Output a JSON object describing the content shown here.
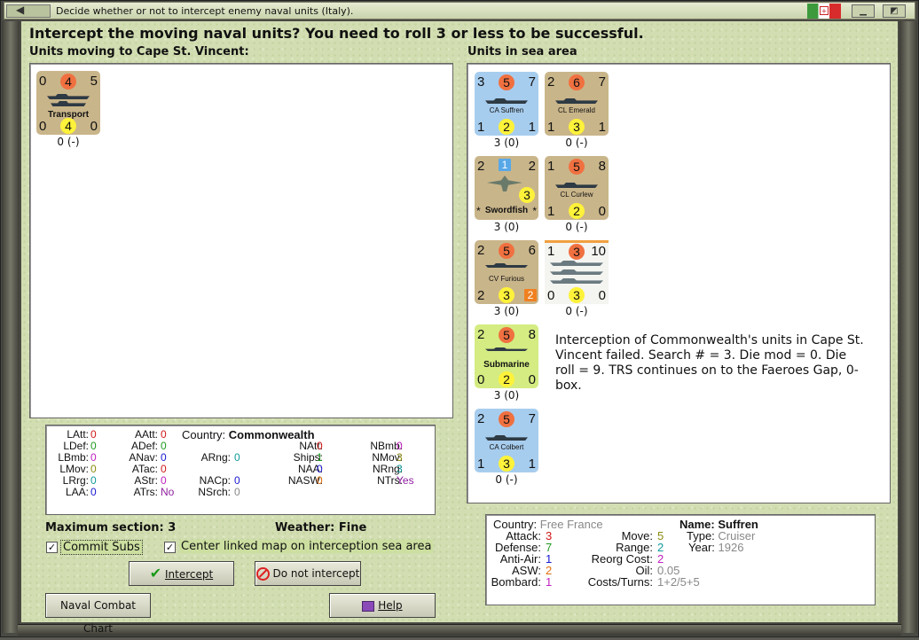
{
  "window": {
    "title": "Decide whether or not to intercept enemy naval units (Italy)."
  },
  "heading": "Intercept the moving naval units?  You need to roll 3 or less to be successful.",
  "left_panel_label": "Units moving to Cape St. Vincent:",
  "right_panel_label": "Units in sea area",
  "moving_units": [
    {
      "tl": "0",
      "tc": "4",
      "tr": "5",
      "name": "Transport",
      "bl": "0",
      "bc": "4",
      "br": "0",
      "status": "0 (-)"
    }
  ],
  "sea_units": [
    {
      "tl": "3",
      "tc": "5",
      "tr": "7",
      "name": "CA Suffren",
      "bl": "1",
      "bc": "2",
      "br": "1",
      "status": "3 (0)"
    },
    {
      "tl": "2",
      "tc": "6",
      "tr": "7",
      "name": "CL Emerald",
      "bl": "1",
      "bc": "3",
      "br": "1",
      "status": "0 (-)"
    },
    {
      "tl": "2",
      "tc": "1",
      "tr": "2",
      "name": "Swordfish",
      "bl": "*",
      "bc": "3",
      "br": "*",
      "status": "3 (0)"
    },
    {
      "tl": "1",
      "tc": "5",
      "tr": "8",
      "name": "CL Curlew",
      "bl": "1",
      "bc": "2",
      "br": "0",
      "status": "0 (-)"
    },
    {
      "tl": "2",
      "tc": "5",
      "tr": "6",
      "name": "CV Furious",
      "bl": "2",
      "bc": "3",
      "br": "2",
      "status": "3 (0)"
    },
    {
      "tl": "1",
      "tc": "3",
      "tr": "10",
      "name": "",
      "bl": "0",
      "bc": "3",
      "br": "0",
      "status": "0 (-)"
    },
    {
      "tl": "2",
      "tc": "5",
      "tr": "8",
      "name": "Submarine",
      "bl": "0",
      "bc": "2",
      "br": "0",
      "status": "3 (0)"
    },
    {
      "tl": "2",
      "tc": "5",
      "tr": "7",
      "name": "CA Colbert",
      "bl": "1",
      "bc": "3",
      "br": "1",
      "status": "0 (-)"
    }
  ],
  "message": "Interception of Commonwealth's units in Cape St. Vincent failed.  Search # = 3.  Die mod = 0.  Die roll = 9.  TRS continues on to the Faeroes Gap, 0-box.",
  "stats": {
    "country_label": "Country:",
    "country": "Commonwealth",
    "col1": [
      {
        "k": "LAtt:",
        "v": "0",
        "c": "#d01818"
      },
      {
        "k": "LDef:",
        "v": "0",
        "c": "#1e9a1e"
      },
      {
        "k": "LBmb:",
        "v": "0",
        "c": "#c020c0"
      },
      {
        "k": "LMov:",
        "v": "0",
        "c": "#8a8a10"
      },
      {
        "k": "LRrg:",
        "v": "0",
        "c": "#109a9a"
      },
      {
        "k": "LAA:",
        "v": "0",
        "c": "#1818d0"
      }
    ],
    "col2": [
      {
        "k": "AAtt:",
        "v": "0",
        "c": "#d01818"
      },
      {
        "k": "ADef:",
        "v": "0",
        "c": "#1e9a1e"
      },
      {
        "k": "ANav:",
        "v": "0",
        "c": "#1818d0"
      },
      {
        "k": "ATac:",
        "v": "0",
        "c": "#d01818"
      },
      {
        "k": "AStr:",
        "v": "0",
        "c": "#c020c0"
      },
      {
        "k": "ATrs:",
        "v": "No",
        "c": "#9020a0"
      }
    ],
    "col3": [
      {
        "k": "ARng:",
        "v": "0",
        "c": "#109a9a"
      },
      {
        "k": "NACp:",
        "v": "0",
        "c": "#1818d0"
      },
      {
        "k": "NSrch:",
        "v": "0",
        "c": "#888888"
      }
    ],
    "col4": [
      {
        "k": "NAtt:",
        "v": "0",
        "c": "#d01818"
      },
      {
        "k": "Ships:",
        "v": "1",
        "c": "#1e9a1e"
      },
      {
        "k": "NAA:",
        "v": "0",
        "c": "#1818d0"
      },
      {
        "k": "NASW:",
        "v": "0",
        "c": "#e07010"
      }
    ],
    "col5": [
      {
        "k": "NBmb:",
        "v": "0",
        "c": "#c020c0"
      },
      {
        "k": "NMov:",
        "v": "3",
        "c": "#8a8a10"
      },
      {
        "k": "NRng:",
        "v": "3",
        "c": "#109a9a"
      },
      {
        "k": "NTrs:",
        "v": "Yes",
        "c": "#9020a0"
      }
    ]
  },
  "max_section": "Maximum section: 3",
  "weather": "Weather:  Fine",
  "commit_subs": {
    "label": "Commit Subs",
    "checked": "✓"
  },
  "center_map": {
    "label": "Center linked map on interception sea area",
    "checked": "✓"
  },
  "buttons": {
    "intercept": "Intercept",
    "no_intercept": "Do not intercept",
    "chart": "Naval Combat Chart",
    "help": "Help"
  },
  "detail": {
    "country_label": "Country:",
    "country": "Free France",
    "name_label": "Name:",
    "name": "Suffren",
    "rows_left": [
      {
        "k": "Attack:",
        "v": "3",
        "c": "#d01818"
      },
      {
        "k": "Defense:",
        "v": "7",
        "c": "#1e9a1e"
      },
      {
        "k": "Anti-Air:",
        "v": "1",
        "c": "#1818d0"
      },
      {
        "k": "ASW:",
        "v": "2",
        "c": "#e07010"
      },
      {
        "k": "Bombard:",
        "v": "1",
        "c": "#c020c0"
      }
    ],
    "rows_mid": [
      {
        "k": "Move:",
        "v": "5",
        "c": "#8a8a10"
      },
      {
        "k": "Range:",
        "v": "2",
        "c": "#109a9a"
      },
      {
        "k": "Reorg Cost:",
        "v": "2",
        "c": "#c020c0"
      },
      {
        "k": "Oil:",
        "v": "0.05",
        "c": "#888888"
      },
      {
        "k": "Costs/Turns:",
        "v": "1+2/5+5",
        "c": "#888888"
      }
    ],
    "type_label": "Type:",
    "type": "Cruiser",
    "year_label": "Year:",
    "year": "1926"
  }
}
